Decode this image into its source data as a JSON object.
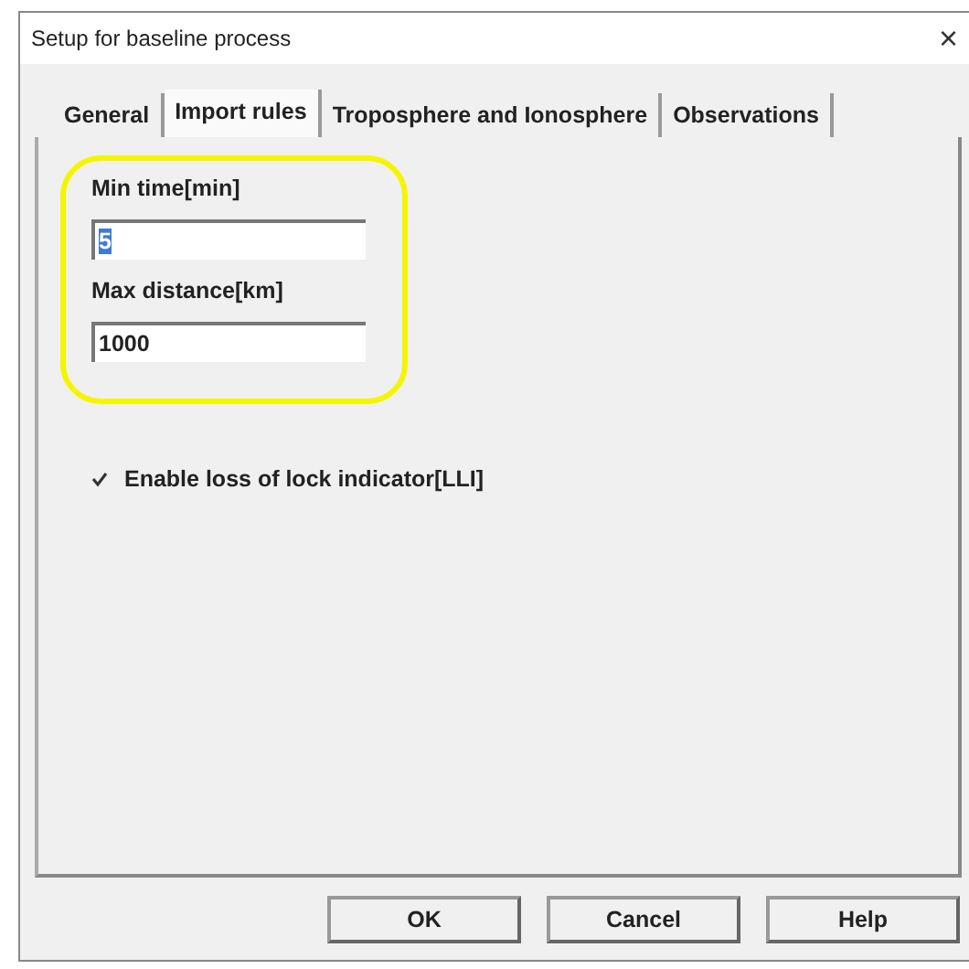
{
  "window": {
    "title": "Setup for baseline process",
    "close": "×"
  },
  "tabs": [
    {
      "label": "General",
      "selected": false
    },
    {
      "label": "Import rules",
      "selected": true
    },
    {
      "label": "Troposphere and Ionosphere",
      "selected": false
    },
    {
      "label": "Observations",
      "selected": false
    }
  ],
  "fields": [
    {
      "label": "Min time[min]",
      "value": "5",
      "text_selected": true
    },
    {
      "label": "Max distance[km]",
      "value": "1000",
      "text_selected": false
    }
  ],
  "checkbox": {
    "label": "Enable loss of lock indicator[LLI]",
    "checked": true
  },
  "buttons": [
    "OK",
    "Cancel",
    "Help"
  ]
}
